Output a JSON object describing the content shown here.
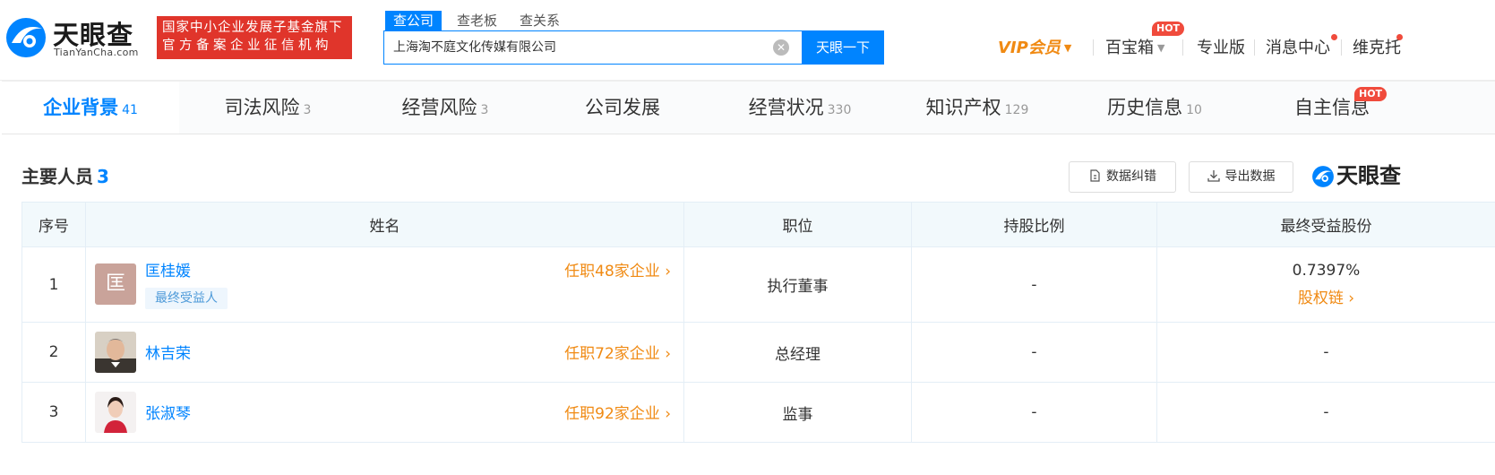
{
  "header": {
    "logo_text": "天眼查",
    "logo_sub": "TianYanCha.com",
    "gov_badge_line1": "国家中小企业发展子基金旗下",
    "gov_badge_line2": "官方备案企业征信机构",
    "search_tabs": [
      "查公司",
      "查老板",
      "查关系"
    ],
    "search_value": "上海淘不庭文化传媒有限公司",
    "search_button": "天眼一下",
    "nav": {
      "vip": "VIP会员",
      "treasure": "百宝箱",
      "treasure_badge": "HOT",
      "pro": "专业版",
      "messages": "消息中心",
      "user": "维克托"
    },
    "accent": "#0084ff",
    "orange": "#f08a13"
  },
  "tabs": [
    {
      "label": "企业背景",
      "count": "41"
    },
    {
      "label": "司法风险",
      "count": "3"
    },
    {
      "label": "经营风险",
      "count": "3"
    },
    {
      "label": "公司发展",
      "count": ""
    },
    {
      "label": "经营状况",
      "count": "330"
    },
    {
      "label": "知识产权",
      "count": "129"
    },
    {
      "label": "历史信息",
      "count": "10"
    },
    {
      "label": "自主信息",
      "count": "",
      "badge": "HOT"
    }
  ],
  "section": {
    "title": "主要人员",
    "count": "3",
    "error_button": "数据纠错",
    "export_button": "导出数据",
    "watermark": "天眼查"
  },
  "table": {
    "headers": [
      "序号",
      "姓名",
      "职位",
      "持股比例",
      "最终受益股份"
    ],
    "rows": [
      {
        "index": "1",
        "avatar_char": "匡",
        "name": "匡桂媛",
        "tag": "最终受益人",
        "link": "任职48家企业",
        "position": "执行董事",
        "share": "-",
        "benefit": "0.7397%",
        "benefit_link": "股权链"
      },
      {
        "index": "2",
        "name": "林吉荣",
        "link": "任职72家企业",
        "position": "总经理",
        "share": "-",
        "benefit": "-"
      },
      {
        "index": "3",
        "name": "张淑琴",
        "link": "任职92家企业",
        "position": "监事",
        "share": "-",
        "benefit": "-"
      }
    ]
  }
}
